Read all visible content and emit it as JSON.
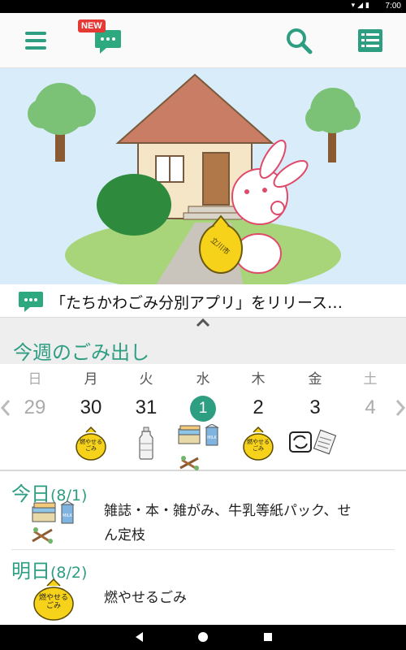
{
  "status_bar": {
    "time": "7:00"
  },
  "app_bar": {
    "new_badge": "NEW",
    "icons": [
      "menu-icon",
      "chat-icon",
      "search-icon",
      "list-icon"
    ],
    "accent": "#2e9e82"
  },
  "hero": {
    "bag_label": "立川市"
  },
  "news": {
    "text": "「たちかわごみ分別アプリ」をリリース…"
  },
  "week": {
    "title": "今週のごみ出し",
    "days": [
      {
        "dow": "日",
        "date": "29",
        "muted": true
      },
      {
        "dow": "月",
        "date": "30",
        "muted": false
      },
      {
        "dow": "火",
        "date": "31",
        "muted": false
      },
      {
        "dow": "水",
        "date": "1",
        "muted": false,
        "today": true
      },
      {
        "dow": "木",
        "date": "2",
        "muted": false
      },
      {
        "dow": "金",
        "date": "3",
        "muted": false
      },
      {
        "dow": "土",
        "date": "4",
        "muted": true
      }
    ],
    "bag_label_line1": "燃やせる",
    "bag_label_line2": "ごみ"
  },
  "today": {
    "title": "今日",
    "date": "(8/1)",
    "text_line1": "雑誌・本・雑がみ、牛乳等紙パック、せ",
    "text_line2": "ん定枝"
  },
  "tomorrow": {
    "title": "明日",
    "date": "(8/2)",
    "text": "燃やせるごみ",
    "bag_label_line1": "燃やせる",
    "bag_label_line2": "ごみ"
  },
  "colors": {
    "accent": "#2e9e82",
    "bag_yellow": "#f7d21a",
    "news_green": "#2ea87e"
  }
}
